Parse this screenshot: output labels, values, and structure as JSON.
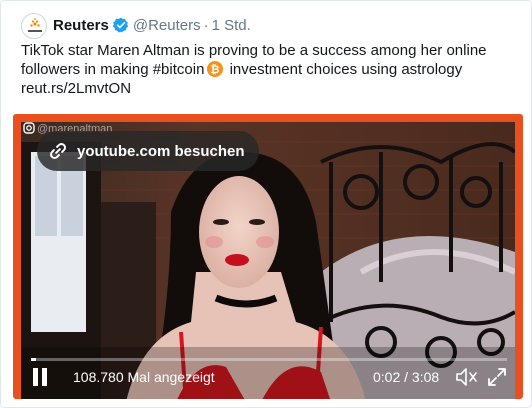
{
  "tweet": {
    "author_name": "Reuters",
    "handle": "@Reuters",
    "separator": "·",
    "time": "1 Std.",
    "text_line1": "TikTok star Maren Altman is proving to be a success among her online",
    "text_line2_before": "followers in making #bitcoin",
    "text_line2_after": " investment choices using astrology",
    "text_line3": "reut.rs/2LmvtON",
    "emoji": "bitcoin-icon"
  },
  "video": {
    "watermark": "marenaltman",
    "youtube_button_label": "youtube.com besuchen",
    "views_label": "108.780 Mal angezeigt",
    "timecode": "0:02 / 3:08",
    "progress_fraction": 0.01
  },
  "colors": {
    "card_border": "#e8501f",
    "text": "#14171a",
    "meta": "#657786",
    "verified": "#1da1f2",
    "bitcoin": "#f7931a"
  }
}
